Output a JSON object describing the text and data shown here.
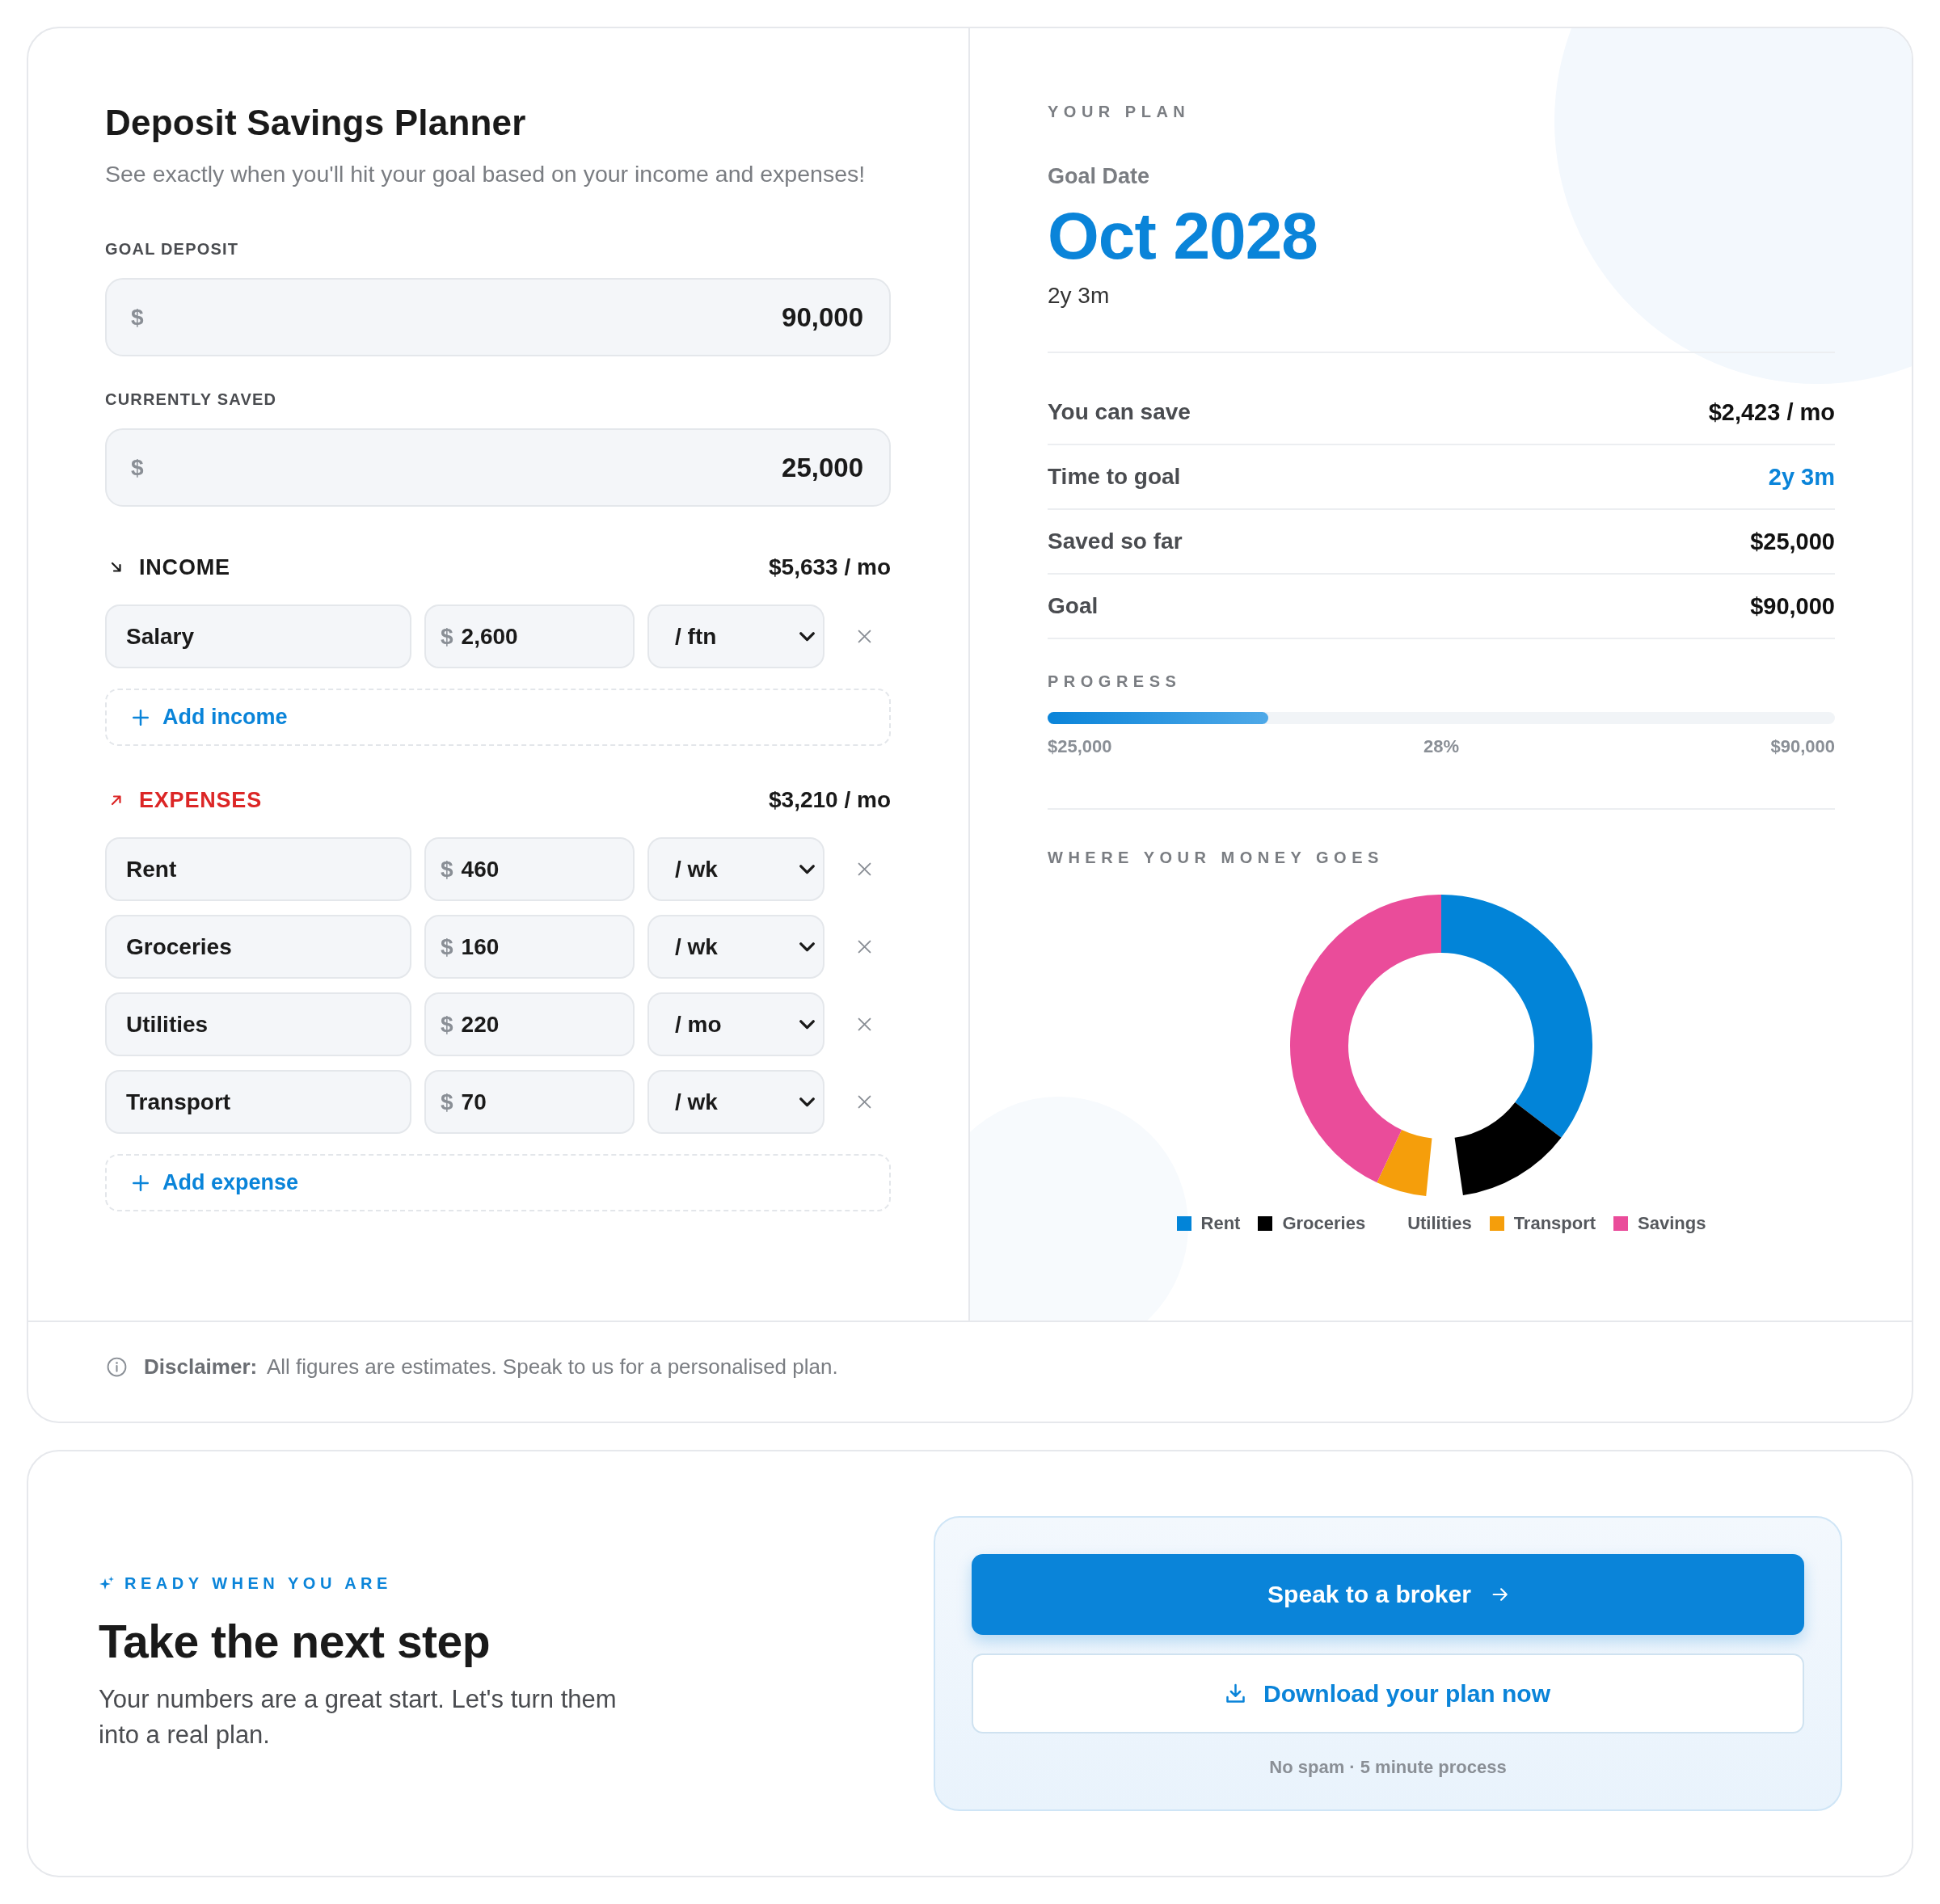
{
  "planner": {
    "title": "Deposit Savings Planner",
    "subtitle": "See exactly when you'll hit your goal based on your income and expenses!",
    "fields": [
      {
        "label": "GOAL DEPOSIT",
        "currency": "$",
        "value": "90,000"
      },
      {
        "label": "CURRENTLY SAVED",
        "currency": "$",
        "value": "25,000"
      }
    ],
    "sections": [
      {
        "kind": "income",
        "title": "INCOME",
        "total": "$5,633 / mo",
        "rows": [
          {
            "name": "Salary",
            "currency": "$",
            "amount": "2,600",
            "period": "/ ftn"
          }
        ],
        "add_label": "Add income"
      },
      {
        "kind": "expense",
        "title": "EXPENSES",
        "total": "$3,210 / mo",
        "rows": [
          {
            "name": "Rent",
            "currency": "$",
            "amount": "460",
            "period": "/ wk"
          },
          {
            "name": "Groceries",
            "currency": "$",
            "amount": "160",
            "period": "/ wk"
          },
          {
            "name": "Utilities",
            "currency": "$",
            "amount": "220",
            "period": "/ mo"
          },
          {
            "name": "Transport",
            "currency": "$",
            "amount": "70",
            "period": "/ wk"
          }
        ],
        "add_label": "Add expense"
      }
    ]
  },
  "plan": {
    "eyebrow": "YOUR PLAN",
    "goal_date_label": "Goal Date",
    "goal_date": "Oct 2028",
    "duration": "2y 3m",
    "stats": [
      {
        "label": "You can save",
        "value": "$2,423 / mo",
        "highlight": false
      },
      {
        "label": "Time to goal",
        "value": "2y 3m",
        "highlight": true
      },
      {
        "label": "Saved so far",
        "value": "$25,000",
        "highlight": false
      },
      {
        "label": "Goal",
        "value": "$90,000",
        "highlight": false
      }
    ],
    "progress": {
      "title": "PROGRESS",
      "level": 0.28,
      "start_label": "$25,000",
      "percent": "28%",
      "end_label": "$90,000"
    },
    "breakdown": {
      "title": "WHERE YOUR MONEY GOES",
      "legend": [
        {
          "label": "Rent",
          "color": "#0284d8"
        },
        {
          "label": "Groceries",
          "color": "#000000"
        },
        {
          "label": "Utilities"
        },
        {
          "label": "Transport",
          "color": "#f59e0b"
        },
        {
          "label": "Savings",
          "color": "#ea4c9a"
        }
      ]
    }
  },
  "disclaimer": {
    "text": "**Disclaimer:** All figures are estimates. Speak to us for a personalised plan."
  },
  "cta": {
    "eyebrow": "READY WHEN YOU ARE",
    "title": "Take the next step",
    "text": "Your numbers are a great start. Let's turn them into a real plan.",
    "primary": "Speak to a broker",
    "secondary": "Download your plan now",
    "note": "No spam · 5 minute process"
  }
}
